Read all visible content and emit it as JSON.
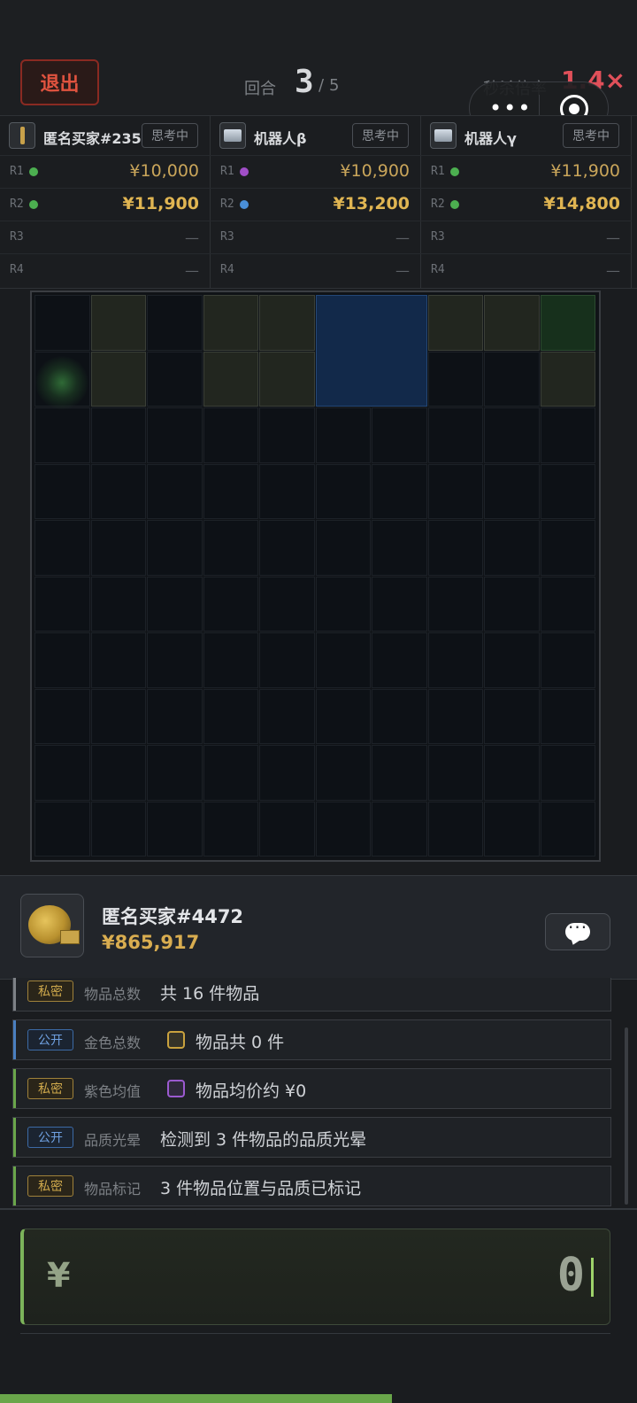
{
  "header": {
    "exit_label": "退出",
    "round_label": "回合",
    "round_current": "3",
    "round_separator": "/",
    "round_total": "5",
    "multiplier_label": "秒杀倍率",
    "multiplier_value": "1.4×"
  },
  "capsule": {
    "more_icon": "•••",
    "close_icon": "target-icon"
  },
  "bidders": [
    {
      "name": "匿名买家#2358",
      "avatar_icon": "pen-icon",
      "status": "思考中",
      "rows": [
        {
          "round": "R1",
          "dot_color": "#4caf50",
          "amount": "¥10,000",
          "bold": false
        },
        {
          "round": "R2",
          "dot_color": "#4caf50",
          "amount": "¥11,900",
          "bold": true
        },
        {
          "round": "R3",
          "dot_color": "",
          "amount": "—",
          "bold": false
        },
        {
          "round": "R4",
          "dot_color": "",
          "amount": "—",
          "bold": false
        }
      ]
    },
    {
      "name": "机器人β",
      "avatar_icon": "card-icon",
      "status": "思考中",
      "rows": [
        {
          "round": "R1",
          "dot_color": "#a04ec7",
          "amount": "¥10,900",
          "bold": false
        },
        {
          "round": "R2",
          "dot_color": "#4a8fd8",
          "amount": "¥13,200",
          "bold": true
        },
        {
          "round": "R3",
          "dot_color": "",
          "amount": "—",
          "bold": false
        },
        {
          "round": "R4",
          "dot_color": "",
          "amount": "—",
          "bold": false
        }
      ]
    },
    {
      "name": "机器人γ",
      "avatar_icon": "card-icon",
      "status": "思考中",
      "rows": [
        {
          "round": "R1",
          "dot_color": "#4caf50",
          "amount": "¥11,900",
          "bold": false
        },
        {
          "round": "R2",
          "dot_color": "#4caf50",
          "amount": "¥14,800",
          "bold": true
        },
        {
          "round": "R3",
          "dot_color": "",
          "amount": "—",
          "bold": false
        },
        {
          "round": "R4",
          "dot_color": "",
          "amount": "—",
          "bold": false
        }
      ]
    }
  ],
  "grid": {
    "rows": 10,
    "cols": 10,
    "highlight_cells": [
      [
        0,
        1
      ],
      [
        0,
        3
      ],
      [
        0,
        4
      ],
      [
        0,
        7
      ],
      [
        0,
        8
      ],
      [
        1,
        1
      ],
      [
        1,
        3
      ],
      [
        1,
        4
      ],
      [
        1,
        9
      ]
    ],
    "green_cells": [
      [
        0,
        9
      ]
    ],
    "blue_block": {
      "row": 0,
      "col": 5,
      "row_span": 2,
      "col_span": 2
    },
    "glow_cell": [
      1,
      0
    ]
  },
  "buyer": {
    "name": "匿名买家#4472",
    "money": "¥865,917",
    "item_icon": "tape-measure-icon",
    "chat_icon": "chat-icon"
  },
  "clues": [
    {
      "tag": "私密",
      "kind": "private",
      "label": "物品总数",
      "text": "共 16 件物品",
      "stripe": "#7d8186",
      "icon": ""
    },
    {
      "tag": "公开",
      "kind": "public",
      "label": "金色总数",
      "text": "物品共 0 件",
      "stripe": "#4a7fc0",
      "icon": "#c9a23e"
    },
    {
      "tag": "私密",
      "kind": "private",
      "label": "紫色均值",
      "text": "物品均价约 ¥0",
      "stripe": "#6aa64a",
      "icon": "#9b5ad0"
    },
    {
      "tag": "公开",
      "kind": "public",
      "label": "品质光晕",
      "text": "检测到 3 件物品的品质光晕",
      "stripe": "#6aa64a",
      "icon": ""
    },
    {
      "tag": "私密",
      "kind": "private",
      "label": "物品标记",
      "text": "3 件物品位置与品质已标记",
      "stripe": "#6aa64a",
      "icon": ""
    }
  ],
  "bid_input": {
    "currency": "¥",
    "value": "0"
  },
  "progress": 0.615
}
